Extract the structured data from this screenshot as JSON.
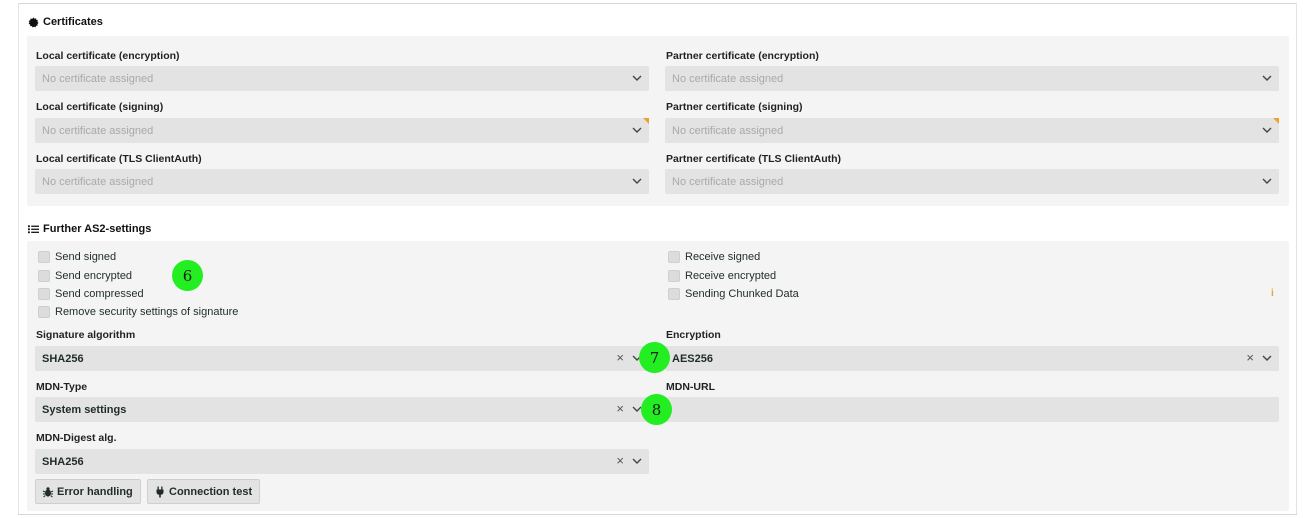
{
  "certificates": {
    "title": "Certificates",
    "local_encryption": {
      "label": "Local certificate (encryption)",
      "placeholder": "No certificate assigned"
    },
    "local_signing": {
      "label": "Local certificate (signing)",
      "placeholder": "No certificate assigned"
    },
    "local_tls": {
      "label": "Local certificate (TLS ClientAuth)",
      "placeholder": "No certificate assigned"
    },
    "partner_encryption": {
      "label": "Partner certificate (encryption)",
      "placeholder": "No certificate assigned"
    },
    "partner_signing": {
      "label": "Partner certificate (signing)",
      "placeholder": "No certificate assigned"
    },
    "partner_tls": {
      "label": "Partner certificate (TLS ClientAuth)",
      "placeholder": "No certificate assigned"
    }
  },
  "as2": {
    "title": "Further AS2-settings",
    "checkboxes_left": [
      {
        "label": "Send signed"
      },
      {
        "label": "Send encrypted"
      },
      {
        "label": "Send compressed"
      },
      {
        "label": "Remove security settings of signature"
      }
    ],
    "checkboxes_right": [
      {
        "label": "Receive signed"
      },
      {
        "label": "Receive encrypted"
      },
      {
        "label": "Sending Chunked Data"
      }
    ],
    "info_glyph": "i",
    "signature_algorithm": {
      "label": "Signature algorithm",
      "value": "SHA256"
    },
    "encryption": {
      "label": "Encryption",
      "value": "AES256"
    },
    "mdn_type": {
      "label": "MDN-Type",
      "value": "System settings"
    },
    "mdn_url": {
      "label": "MDN-URL",
      "value": ""
    },
    "mdn_digest": {
      "label": "MDN-Digest alg.",
      "value": "SHA256"
    },
    "clear_glyph": "×",
    "buttons": {
      "error_handling": "Error handling",
      "connection_test": "Connection test"
    }
  },
  "markers": {
    "m6": "6",
    "m7": "7",
    "m8": "8"
  },
  "colors": {
    "marker": "#22ee22",
    "panel": "#f4f4f4",
    "field": "#e3e3e3",
    "warning_corner": "#f0a030",
    "info": "#e8a23a"
  },
  "icons": {
    "certificates": "gear-badge-icon",
    "settings": "list-icon",
    "error_handling": "bug-icon",
    "connection_test": "plug-icon",
    "dropdown": "chevron-down-icon",
    "clear": "close-icon"
  }
}
